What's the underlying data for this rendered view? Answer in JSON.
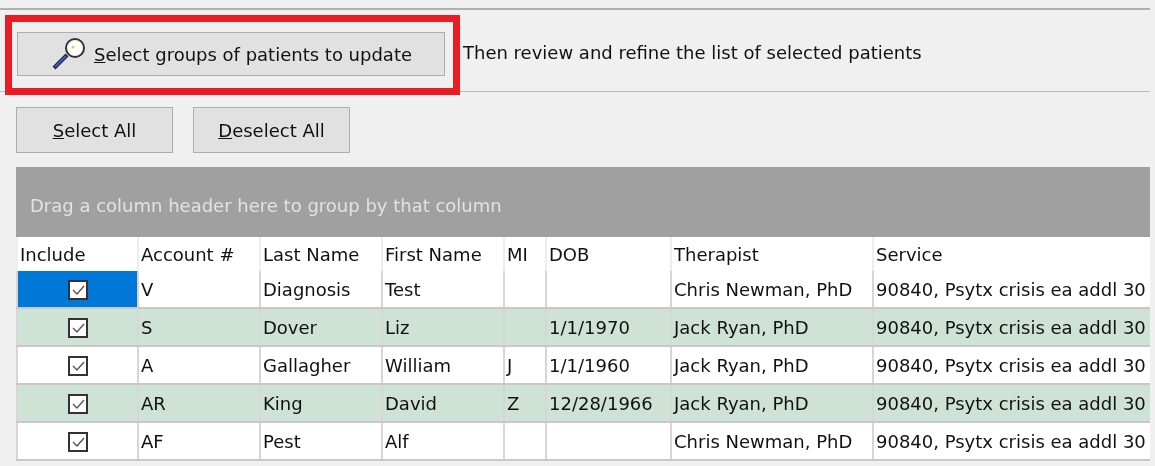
{
  "toolbar": {
    "select_groups_button": {
      "label": "Select groups of patients to update",
      "first_letter_underlined": true,
      "highlighted": true
    },
    "hint": "Then review and refine the list of selected patients"
  },
  "selection_buttons": [
    {
      "label": "Select All",
      "first_letter_underlined": true
    },
    {
      "label": "Deselect All",
      "first_letter_underlined": true
    }
  ],
  "grid": {
    "group_panel": {
      "placeholder": "Drag a column header here to group by that column"
    },
    "include_column": "Include",
    "columns": [
      "Account #",
      "Last Name",
      "First Name",
      "MI",
      "DOB",
      "Therapist",
      "Service"
    ],
    "rows": [
      {
        "include": true,
        "focused": true,
        "cells": [
          "V",
          "Diagnosis",
          "Test",
          "",
          "",
          "Chris Newman, PhD",
          "90840, Psytx crisis ea addl 30"
        ]
      },
      {
        "include": true,
        "focused": false,
        "cells": [
          "S",
          "Dover",
          "Liz",
          "",
          "1/1/1970",
          "Jack Ryan, PhD",
          "90840, Psytx crisis ea addl 30"
        ]
      },
      {
        "include": true,
        "focused": false,
        "cells": [
          "A",
          "Gallagher",
          "William",
          "J",
          "1/1/1960",
          "Jack Ryan, PhD",
          "90840, Psytx crisis ea addl 30"
        ]
      },
      {
        "include": true,
        "focused": false,
        "cells": [
          "AR",
          "King",
          "David",
          "Z",
          "12/28/1966",
          "Jack Ryan, PhD",
          "90840, Psytx crisis ea addl 30"
        ]
      },
      {
        "include": true,
        "focused": false,
        "cells": [
          "AF",
          "Pest",
          "Alf",
          "",
          "",
          "Chris Newman, PhD",
          "90840, Psytx crisis ea addl 30"
        ]
      }
    ]
  }
}
